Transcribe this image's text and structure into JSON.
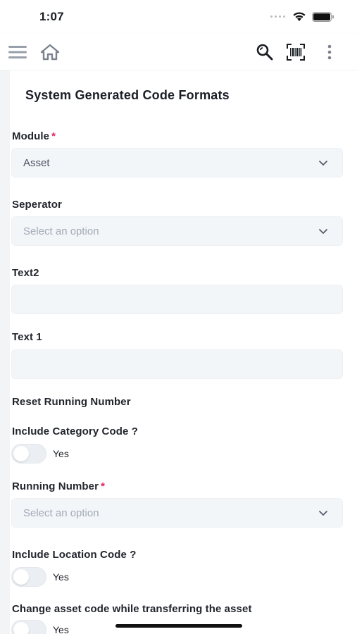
{
  "status_bar": {
    "time": "1:07"
  },
  "app_bar": {
    "menu_icon": "hamburger-menu-icon",
    "home_icon": "home-icon",
    "search_icon": "search-icon",
    "barcode_icon": "barcode-scan-icon",
    "more_icon": "more-vertical-icon"
  },
  "page": {
    "title": "System Generated Code Formats"
  },
  "form": {
    "module": {
      "label": "Module",
      "required": "*",
      "value": "Asset"
    },
    "seperator": {
      "label": "Seperator",
      "placeholder": "Select an option"
    },
    "text2": {
      "label": "Text2",
      "value": ""
    },
    "text1": {
      "label": "Text 1",
      "value": ""
    },
    "reset_running_number": {
      "label": "Reset Running Number"
    },
    "include_category_code": {
      "label": "Include Category Code ?",
      "toggle_label": "Yes",
      "checked": false
    },
    "running_number": {
      "label": "Running Number",
      "required": "*",
      "placeholder": "Select an option"
    },
    "include_location_code": {
      "label": "Include Location Code ?",
      "toggle_label": "Yes",
      "checked": false
    },
    "change_asset_code": {
      "label": "Change asset code while transferring the asset",
      "toggle_label": "Yes",
      "checked": false
    }
  },
  "colors": {
    "required": "#e0245e",
    "field_bg": "#f3f6f8",
    "placeholder": "#a3aab8"
  }
}
